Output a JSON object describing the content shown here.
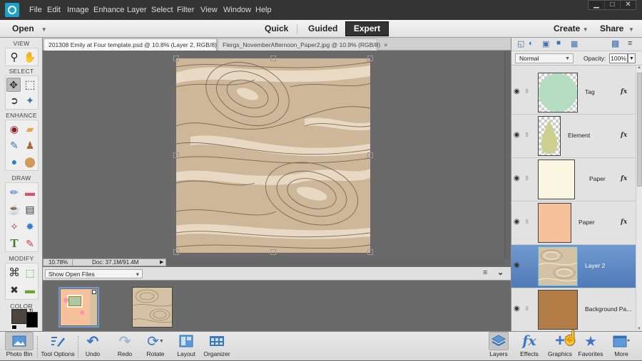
{
  "menubar": {
    "logo_icon": "photoshop-elements-logo",
    "items": [
      "File",
      "Edit",
      "Image",
      "Enhance",
      "Layer",
      "Select",
      "Filter",
      "View",
      "Window",
      "Help"
    ],
    "window_controls": [
      "minimize",
      "restore",
      "close"
    ],
    "window_glyphs": [
      "▁",
      "□",
      "✕"
    ]
  },
  "modebar": {
    "open_label": "Open",
    "modes": [
      "Quick",
      "Guided",
      "Expert"
    ],
    "active_mode": "Expert",
    "create_label": "Create",
    "share_label": "Share"
  },
  "toolbox": {
    "sections": [
      "VIEW",
      "SELECT",
      "ENHANCE",
      "DRAW",
      "MODIFY",
      "COLOR"
    ],
    "tools": {
      "zoom": "🔍",
      "hand": "✋",
      "move": "✥",
      "marquee": "⬚",
      "lasso": "⬭",
      "quick_select": "✦",
      "red_eye": "👁",
      "spot_healing": "✂",
      "smart_brush": "✎",
      "clone_stamp": "♙",
      "blur": "💧",
      "sponge": "●",
      "brush": "✏",
      "eraser": "▬",
      "paint_bucket": "☕",
      "gradient": "▤",
      "eyedropper": "✧",
      "custom_shape": "✸",
      "type": "T",
      "pencil": "✎",
      "crop": "⌗",
      "recompose": "⬚",
      "content_aware_move": "✖",
      "straighten": "▬"
    },
    "colors": {
      "foreground": "#4e463e",
      "background": "#000000"
    }
  },
  "tabs": [
    {
      "label": "201308 Emily at Four template.psd @ 10.8% (Layer 2, RGB/8) *",
      "active": true
    },
    {
      "label": "Flergs_NovemberAfternoon_Paper2.jpg @ 10.9% (RGB/8)",
      "active": false
    }
  ],
  "tab_close_glyph": "×",
  "status": {
    "zoom": "10.78%",
    "doc": "Doc: 37.1M/91.4M",
    "arrow": "▶"
  },
  "photo_bin": {
    "show_label": "Show Open Files",
    "caret": "▾",
    "menu_glyph": "≡",
    "collapse_glyph": "⌄",
    "thumbnails": [
      "201308 Emily at Four template.psd",
      "Flergs_NovemberAfternoon_Paper2.jpg"
    ]
  },
  "layers_panel": {
    "toolbar_icons": [
      "new-layer-icon",
      "adjustment-layer-icon",
      "layer-mask-icon",
      "lock-all-icon",
      "lock-transparent-icon",
      "delete-layer-icon",
      "panel-menu-icon"
    ],
    "toolbar_glyphs": [
      "◱",
      "◐",
      "▣",
      "🔒",
      "▦",
      "🗑",
      "≡"
    ],
    "blend_mode": "Normal",
    "opacity_label": "Opacity:",
    "opacity_value": "100%",
    "eye_glyph": "👁",
    "link_glyph": "⬮",
    "fx_glyph": "fx",
    "layers": [
      {
        "name": "Tag",
        "fx": true,
        "selected": false,
        "thumb_color": "#b5ddc1",
        "kind": "circle"
      },
      {
        "name": "Element",
        "fx": true,
        "selected": false,
        "thumb_color": "#cccf8e",
        "kind": "drop"
      },
      {
        "name": "Paper",
        "fx": true,
        "selected": false,
        "thumb_color": "#fbf6e2",
        "kind": "solid"
      },
      {
        "name": "Paper",
        "fx": true,
        "selected": false,
        "thumb_color": "#f7c29b",
        "kind": "solid"
      },
      {
        "name": "Layer 2",
        "fx": false,
        "selected": true,
        "thumb_color": "#d5c1a4",
        "kind": "wood"
      },
      {
        "name": "Background Pa...",
        "fx": false,
        "selected": false,
        "thumb_color": "#b37d47",
        "kind": "solid"
      }
    ],
    "partial_top_color": "#b37d47"
  },
  "bottombar": {
    "left": [
      {
        "label": "Photo Bin",
        "icon": "photo-bin-icon",
        "active": true
      },
      {
        "label": "Tool Options",
        "icon": "tool-options-icon",
        "active": false
      },
      {
        "label": "Undo",
        "icon": "undo-icon",
        "active": false
      },
      {
        "label": "Redo",
        "icon": "redo-icon",
        "active": false
      },
      {
        "label": "Rotate",
        "icon": "rotate-icon",
        "active": false
      },
      {
        "label": "Layout",
        "icon": "layout-icon",
        "active": false
      },
      {
        "label": "Organizer",
        "icon": "organizer-icon",
        "active": false
      }
    ],
    "right": [
      {
        "label": "Layers",
        "icon": "layers-icon",
        "active": true
      },
      {
        "label": "Effects",
        "icon": "effects-icon",
        "active": false
      },
      {
        "label": "Graphics",
        "icon": "graphics-icon",
        "active": false
      },
      {
        "label": "Favorites",
        "icon": "favorites-icon",
        "active": false
      },
      {
        "label": "More",
        "icon": "more-icon",
        "active": false
      }
    ]
  },
  "cursor": "hand-pointer"
}
